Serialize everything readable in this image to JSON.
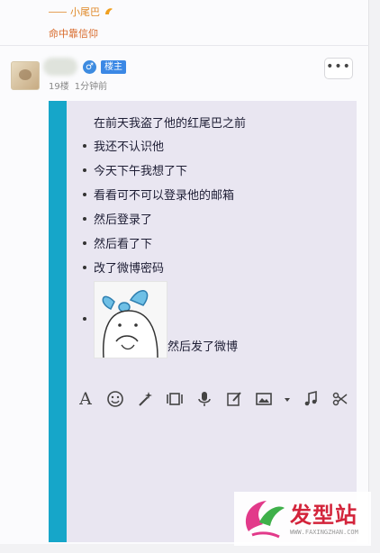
{
  "signature": {
    "tail_label": "小尾巴",
    "motto": "命中靠信仰"
  },
  "post": {
    "floor": "19楼",
    "time": "1分钟前",
    "gender_symbol": "♂",
    "role_badge": "楼主",
    "more_label": "•••"
  },
  "message": {
    "lines": [
      "在前天我盗了他的红尾巴之前",
      "我还不认识他",
      "今天下午我想了下",
      "看看可不可以登录他的邮箱",
      "然后登录了",
      "然后看了下",
      "改了微博密码"
    ],
    "sticker_caption": "然后发了微博"
  },
  "toolbar": {
    "items": [
      "text-format-icon",
      "emoji-icon",
      "magic-wand-icon",
      "video-icon",
      "microphone-icon",
      "edit-icon",
      "image-icon",
      "dropdown-caret-icon",
      "music-icon",
      "scissors-icon"
    ],
    "text_glyph": "A"
  },
  "watermark": {
    "title": "发型站",
    "url": "WWW.FAXINGZHAN.COM"
  },
  "colors": {
    "accent_blue": "#16a6c9",
    "badge_blue": "#3b88e5",
    "watermark_red": "#d3243b",
    "motto_orange": "#d86a2a"
  }
}
